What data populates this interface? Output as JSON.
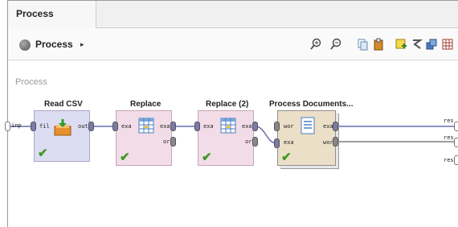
{
  "tab": {
    "title": "Process"
  },
  "breadcrumb": {
    "label": "Process",
    "arrow": "▸"
  },
  "canvas": {
    "label": "Process"
  },
  "ports": {
    "input": "inp",
    "results": [
      "res",
      "res",
      "res"
    ]
  },
  "operators": [
    {
      "title": "Read CSV",
      "in": [
        "fil"
      ],
      "out": [
        "out"
      ]
    },
    {
      "title": "Replace",
      "in": [
        "exa"
      ],
      "out": [
        "exa",
        "ori"
      ]
    },
    {
      "title": "Replace (2)",
      "in": [
        "exa"
      ],
      "out": [
        "exa",
        "ori"
      ]
    },
    {
      "title": "Process Documents...",
      "in": [
        "wor",
        "exa"
      ],
      "out": [
        "exa",
        "wor"
      ]
    }
  ],
  "colors": {
    "wire": "#6a6ab0",
    "check": "#3d9a20"
  }
}
